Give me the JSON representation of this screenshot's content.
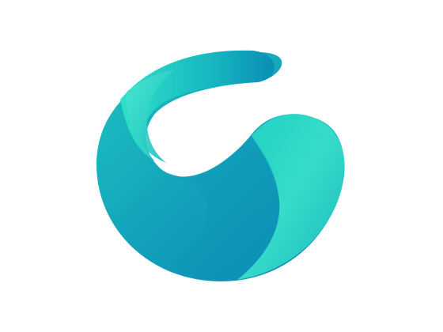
{
  "logo": {
    "icon": "teal-swirl-logo-icon",
    "colors": {
      "background": "#ffffff",
      "teal_light": "#3EE3C8",
      "teal_mid": "#19C3BE",
      "teal_dark": "#0A8FB8",
      "blue_deep": "#0B7FB3"
    }
  }
}
